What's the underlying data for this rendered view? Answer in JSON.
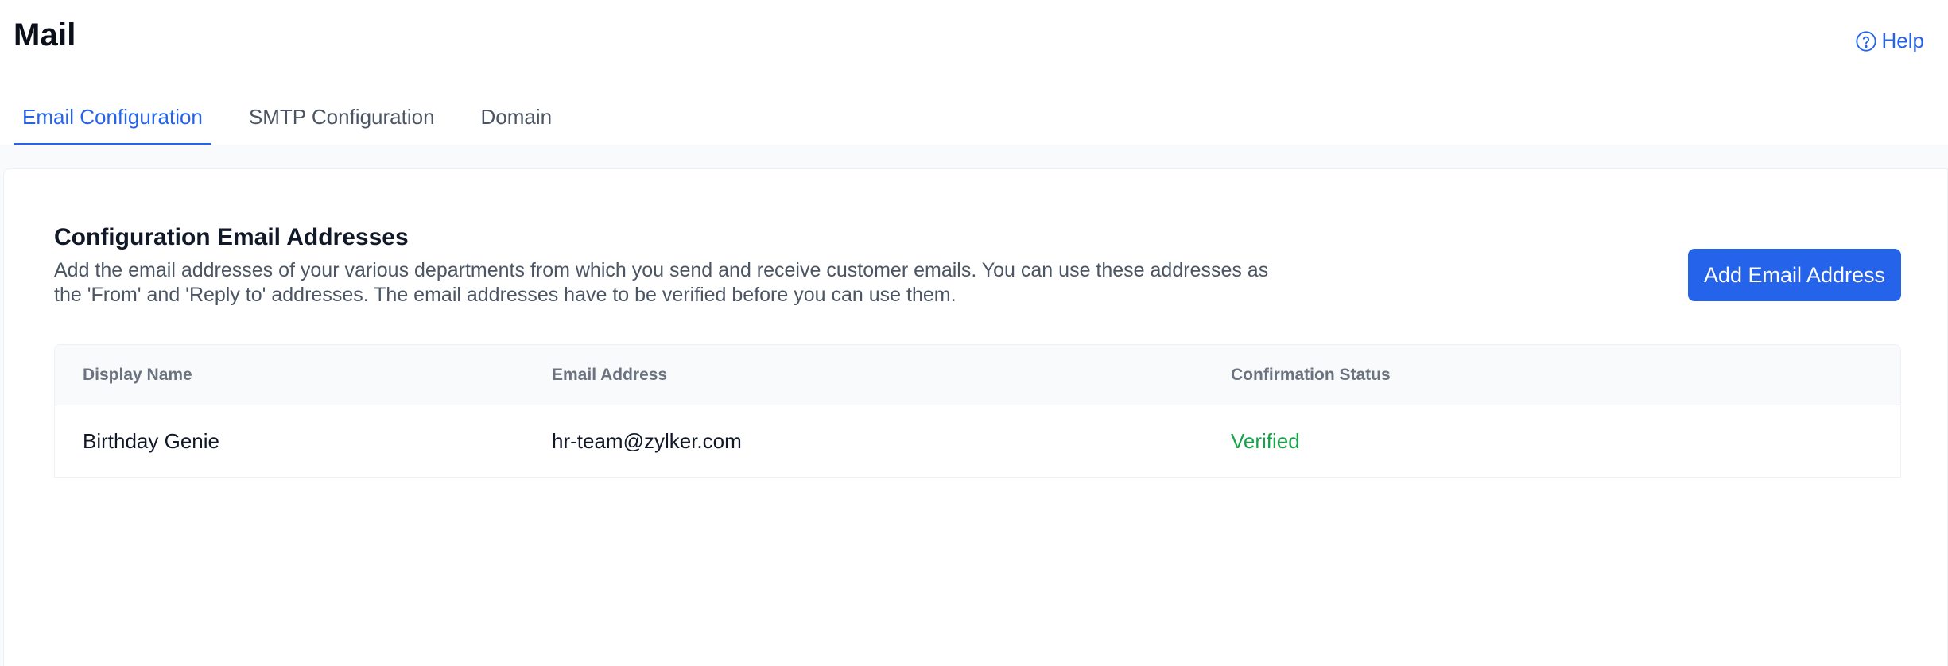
{
  "header": {
    "title": "Mail",
    "help_label": "Help"
  },
  "tabs": [
    {
      "label": "Email Configuration",
      "active": true
    },
    {
      "label": "SMTP Configuration",
      "active": false
    },
    {
      "label": "Domain",
      "active": false
    }
  ],
  "section": {
    "title": "Configuration Email Addresses",
    "description": "Add the email addresses of your various departments from which you send and receive customer emails. You can use these addresses as the 'From' and 'Reply to' addresses. The email addresses have to be verified before you can use them.",
    "add_button_label": "Add Email Address"
  },
  "table": {
    "columns": [
      "Display Name",
      "Email Address",
      "Confirmation Status"
    ],
    "rows": [
      {
        "display_name": "Birthday Genie",
        "email": "hr-team@zylker.com",
        "status": "Verified"
      }
    ]
  },
  "colors": {
    "accent": "#2563eb",
    "verified": "#16a34a"
  },
  "icons": {
    "help": "help-circle-icon"
  }
}
